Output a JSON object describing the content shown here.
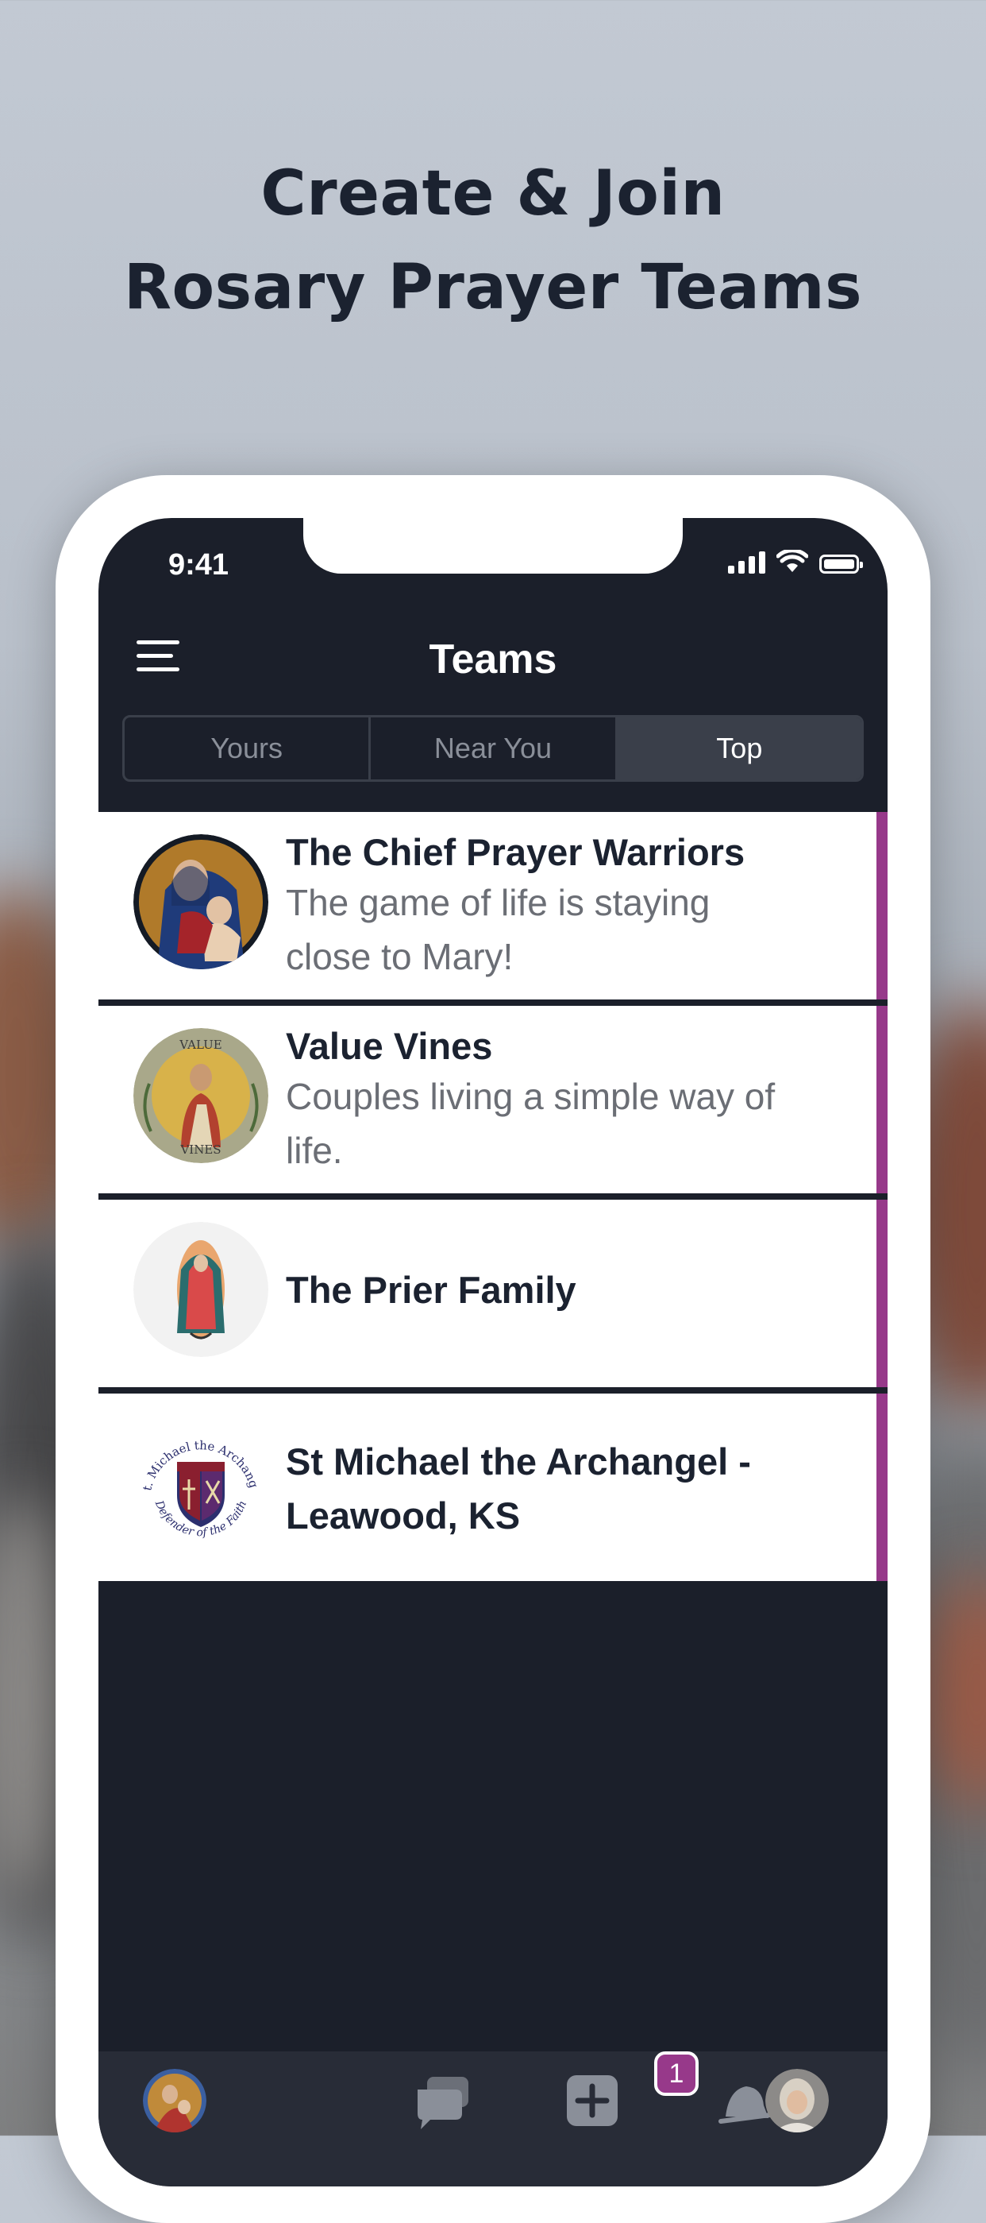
{
  "headline": {
    "line1": "Create & Join",
    "line2": "Rosary Prayer Teams"
  },
  "status_bar": {
    "time": "9:41"
  },
  "nav": {
    "title": "Teams"
  },
  "segments": [
    {
      "label": "Yours",
      "active": false
    },
    {
      "label": "Near You",
      "active": false
    },
    {
      "label": "Top",
      "active": true
    }
  ],
  "teams": [
    {
      "name": "The Chief Prayer Warriors",
      "description": "The game of life is staying close to Mary!",
      "avatar": "madonna-and-child-icon"
    },
    {
      "name": "Value Vines",
      "description": "Couples living a simple way of life.",
      "avatar": "value-vines-logo",
      "avatar_text_top": "VALUE",
      "avatar_text_bottom": "VINES"
    },
    {
      "name": "The Prier Family",
      "description": "",
      "avatar": "our-lady-of-guadalupe-icon"
    },
    {
      "name": "St Michael the Archangel - Leawood, KS",
      "description": "",
      "avatar": "st-michael-crest",
      "avatar_text_top": "St. Michael the Archangel",
      "avatar_text_bottom": "Defender of the Faith"
    }
  ],
  "tab_bar": {
    "items": [
      "home-icon",
      "chat-icon",
      "add-icon",
      "notifications-icon",
      "profile-avatar"
    ],
    "notification_count": "1"
  },
  "colors": {
    "accent": "#97398a",
    "screen_bg": "#1b1f2a",
    "card_bg": "#ffffff"
  }
}
